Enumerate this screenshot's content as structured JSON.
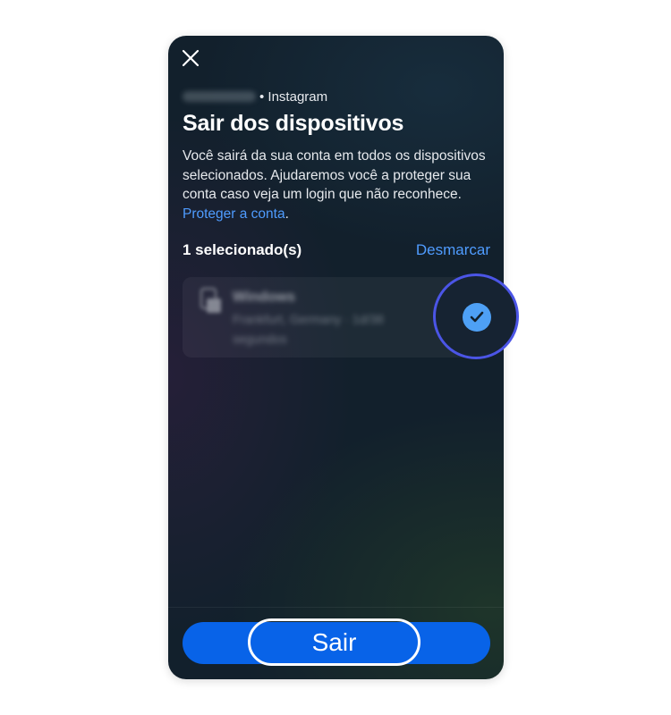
{
  "header": {
    "close_icon": "close-icon",
    "account_separator_app": "• Instagram",
    "title": "Sair dos dispositivos"
  },
  "description": {
    "text": "Você sairá da sua conta em todos os dispositivos selecionados. Ajudaremos você a proteger sua conta caso veja um login que não reconhece. ",
    "link": "Proteger a conta",
    "suffix": "."
  },
  "selection": {
    "count_label": "1 selecionado(s)",
    "unselect_label": "Desmarcar"
  },
  "device": {
    "name": "Windows",
    "meta": "Frankfurt, Germany · 1d/38 segundos",
    "selected": true,
    "icon": "computer-icon",
    "check_icon": "checkmark-icon"
  },
  "footer": {
    "exit_label": "Sair"
  },
  "colors": {
    "accent": "#4f9cff",
    "button": "#0863e8",
    "highlight_ring": "#4b55e6",
    "background": "#12202c"
  }
}
